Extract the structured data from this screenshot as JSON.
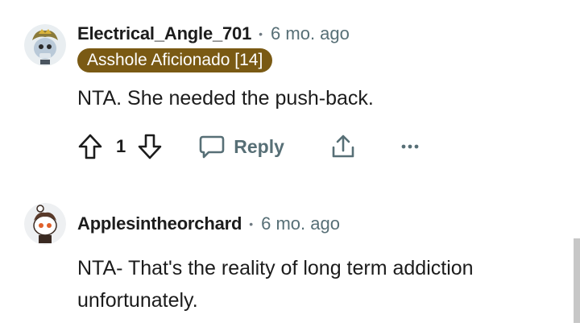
{
  "comments": [
    {
      "username": "Electrical_Angle_701",
      "separator": "•",
      "time": "6 mo. ago",
      "flair": "Asshole Aficionado [14]",
      "text": "NTA. She needed the push-back.",
      "vote_count": "1",
      "reply_label": "Reply",
      "avatar_icon": "snoo-avatar-icon"
    },
    {
      "username": "Applesintheorchard",
      "separator": "•",
      "time": "6 mo. ago",
      "text_lines": [
        "NTA- That's the reality of long term addiction",
        "unfortunately."
      ],
      "avatar_icon": "snoo-avatar-icon"
    }
  ],
  "colors": {
    "flair_bg": "#7a5a14",
    "muted_text": "#576f76",
    "primary_text": "#1c1c1c"
  }
}
